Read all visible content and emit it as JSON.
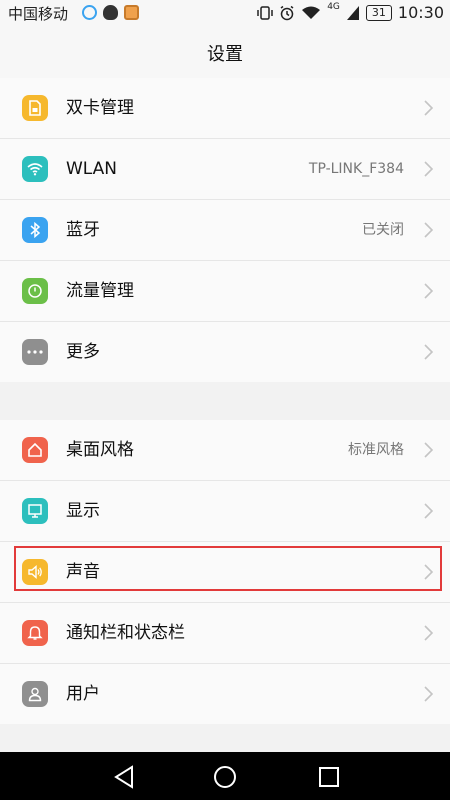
{
  "status_bar": {
    "carrier": "中国移动",
    "network": "4G",
    "battery": "31",
    "time": "10:30"
  },
  "header": {
    "title": "设置"
  },
  "group1": [
    {
      "label": "双卡管理",
      "value": "",
      "icon": "sim-card-icon",
      "color": "#f6b82d"
    },
    {
      "label": "WLAN",
      "value": "TP-LINK_F384",
      "icon": "wifi-icon",
      "color": "#2cbfbd"
    },
    {
      "label": "蓝牙",
      "value": "已关闭",
      "icon": "bluetooth-icon",
      "color": "#3aa3f0"
    },
    {
      "label": "流量管理",
      "value": "",
      "icon": "data-usage-icon",
      "color": "#6bbf48"
    },
    {
      "label": "更多",
      "value": "",
      "icon": "more-icon",
      "color": "#8f8f8f"
    }
  ],
  "group2": [
    {
      "label": "桌面风格",
      "value": "标准风格",
      "icon": "home-icon",
      "color": "#f0634c"
    },
    {
      "label": "显示",
      "value": "",
      "icon": "display-icon",
      "color": "#2cbfbd"
    },
    {
      "label": "声音",
      "value": "",
      "icon": "sound-icon",
      "color": "#f6b82d"
    },
    {
      "label": "通知栏和状态栏",
      "value": "",
      "icon": "notification-icon",
      "color": "#f0634c"
    },
    {
      "label": "用户",
      "value": "",
      "icon": "user-icon",
      "color": "#8f8f8f"
    }
  ]
}
